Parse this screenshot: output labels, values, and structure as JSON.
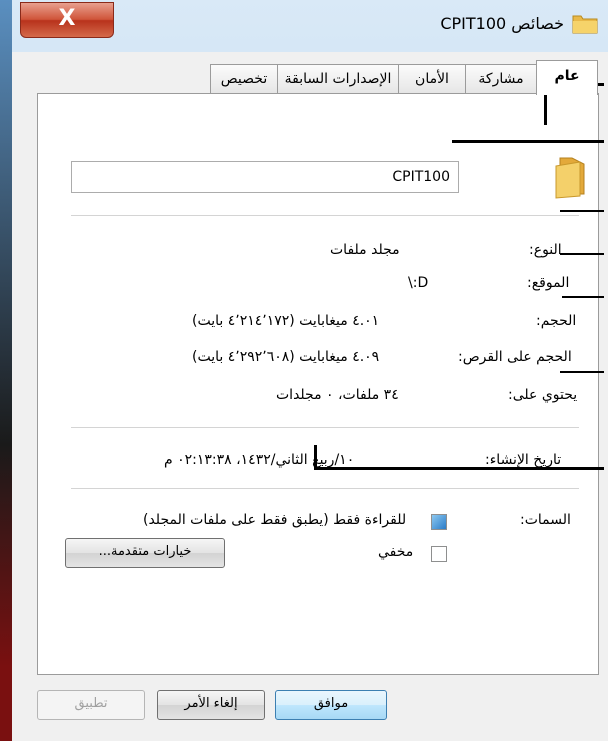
{
  "window": {
    "title": "خصائص CPIT100",
    "close_label": "X"
  },
  "tabs": [
    {
      "label": "عام"
    },
    {
      "label": "مشاركة"
    },
    {
      "label": "الأمان"
    },
    {
      "label": "الإصدارات السابقة"
    },
    {
      "label": "تخصيص"
    }
  ],
  "general": {
    "folder_name": "CPIT100",
    "type_label": "النوع:",
    "type_value": "مجلد ملفات",
    "location_label": "الموقع:",
    "location_value": "D:\\",
    "size_label": "الحجم:",
    "size_value": "٤.٠١ ميغابايت (٤٬٢١٤٬١٧٢ بايت)",
    "size_on_disk_label": "الحجم على القرص:",
    "size_on_disk_value": "٤.٠٩ ميغابايت (٤٬٢٩٢٬٦٠٨ بايت)",
    "contains_label": "يحتوي على:",
    "contains_value": "٣٤ ملفات، ٠ مجلدات",
    "created_label": "تاريخ الإنشاء:",
    "created_value": "١٠/ربيع الثاني/١٤٣٢، ٠٢:١٣:٣٨ م",
    "attributes_label": "السمات:",
    "readonly_label": "للقراءة فقط (يطبق فقط على ملفات المجلد)",
    "readonly_checked": "partial",
    "hidden_label": "مخفي",
    "hidden_checked": false,
    "advanced_button": "خيارات متقدمة..."
  },
  "footer": {
    "ok": "موافق",
    "cancel": "إلغاء الأمر",
    "apply": "تطبيق"
  },
  "icons": [
    "folder-icon",
    "close-icon"
  ],
  "colors": {
    "titlebar": "#c6dcef",
    "close_button": "#c7432a",
    "ok_border": "#3c7fb1"
  }
}
